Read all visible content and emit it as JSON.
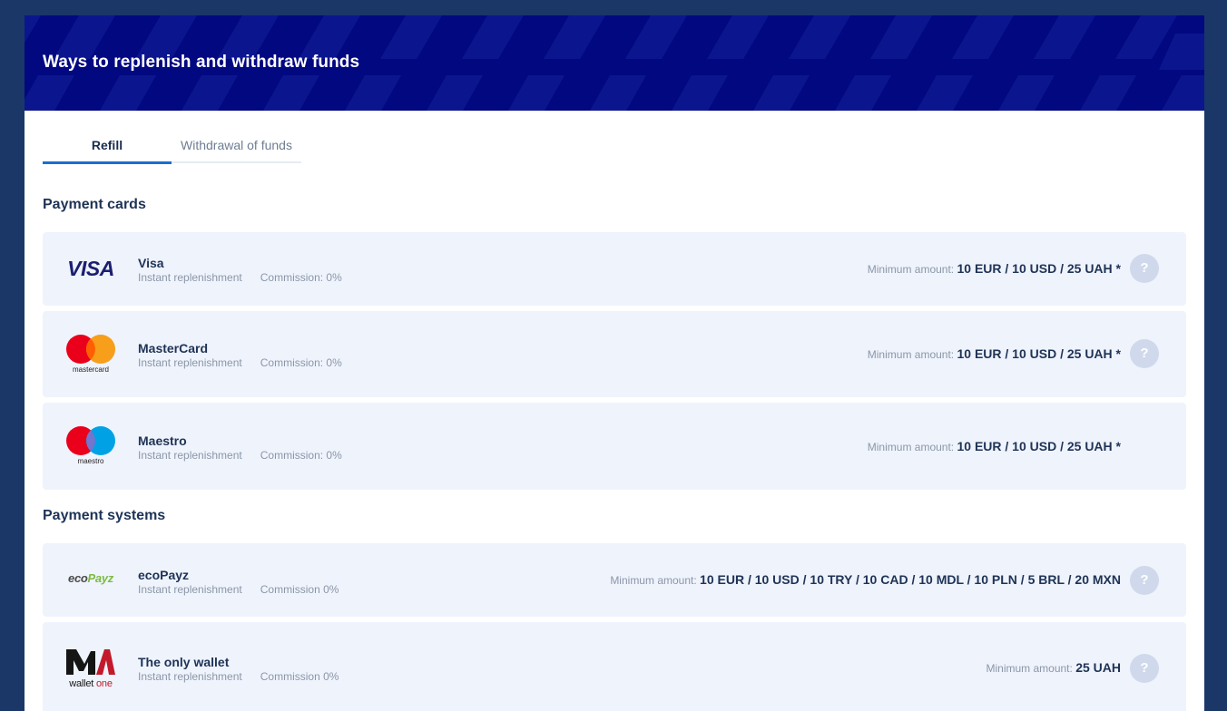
{
  "banner": {
    "title": "Ways to replenish and withdraw funds"
  },
  "tabs": [
    {
      "label": "Refill"
    },
    {
      "label": "Withdrawal of funds"
    }
  ],
  "sections": [
    {
      "title": "Payment cards"
    },
    {
      "title": "Payment systems"
    }
  ],
  "methods": [
    {
      "name": "Visa",
      "logo": "visa-logo",
      "logo_text": "VISA",
      "subtitle": "Instant replenishment",
      "commission": "Commission: 0%",
      "min_label": "Minimum amount:",
      "min_value": "10 EUR / 10 USD / 25 UAH *",
      "help": "?"
    },
    {
      "name": "MasterCard",
      "logo": "mastercard-logo",
      "logo_text": "mastercard",
      "subtitle": "Instant replenishment",
      "commission": "Commission: 0%",
      "min_label": "Minimum amount:",
      "min_value": "10 EUR / 10 USD / 25 UAH *",
      "help": "?"
    },
    {
      "name": "Maestro",
      "logo": "maestro-logo",
      "logo_text": "maestro",
      "subtitle": "Instant replenishment",
      "commission": "Commission: 0%",
      "min_label": "Minimum amount:",
      "min_value": "10 EUR / 10 USD / 25 UAH *"
    },
    {
      "name": "ecoPayz",
      "logo": "ecopayz-logo",
      "logo_text_a": "eco",
      "logo_text_b": "Payz",
      "subtitle": "Instant replenishment",
      "commission": "Commission 0%",
      "min_label": "Minimum amount:",
      "min_value": "10 EUR / 10 USD / 10 TRY / 10 CAD / 10 MDL / 10 PLN / 5 BRL / 20 MXN",
      "help": "?"
    },
    {
      "name": "The only wallet",
      "logo": "wallet-one-logo",
      "logo_text_a": "wallet",
      "logo_text_b": "one",
      "subtitle": "Instant replenishment",
      "commission": "Commission 0%",
      "min_label": "Minimum amount:",
      "min_value": "25 UAH",
      "help": "?"
    }
  ],
  "colors": {
    "background": "#1a3768",
    "banner": "#020880",
    "row": "#eff3fc",
    "accent": "#1a6fd1",
    "text": "#1e3356",
    "muted": "#8b97a8"
  }
}
